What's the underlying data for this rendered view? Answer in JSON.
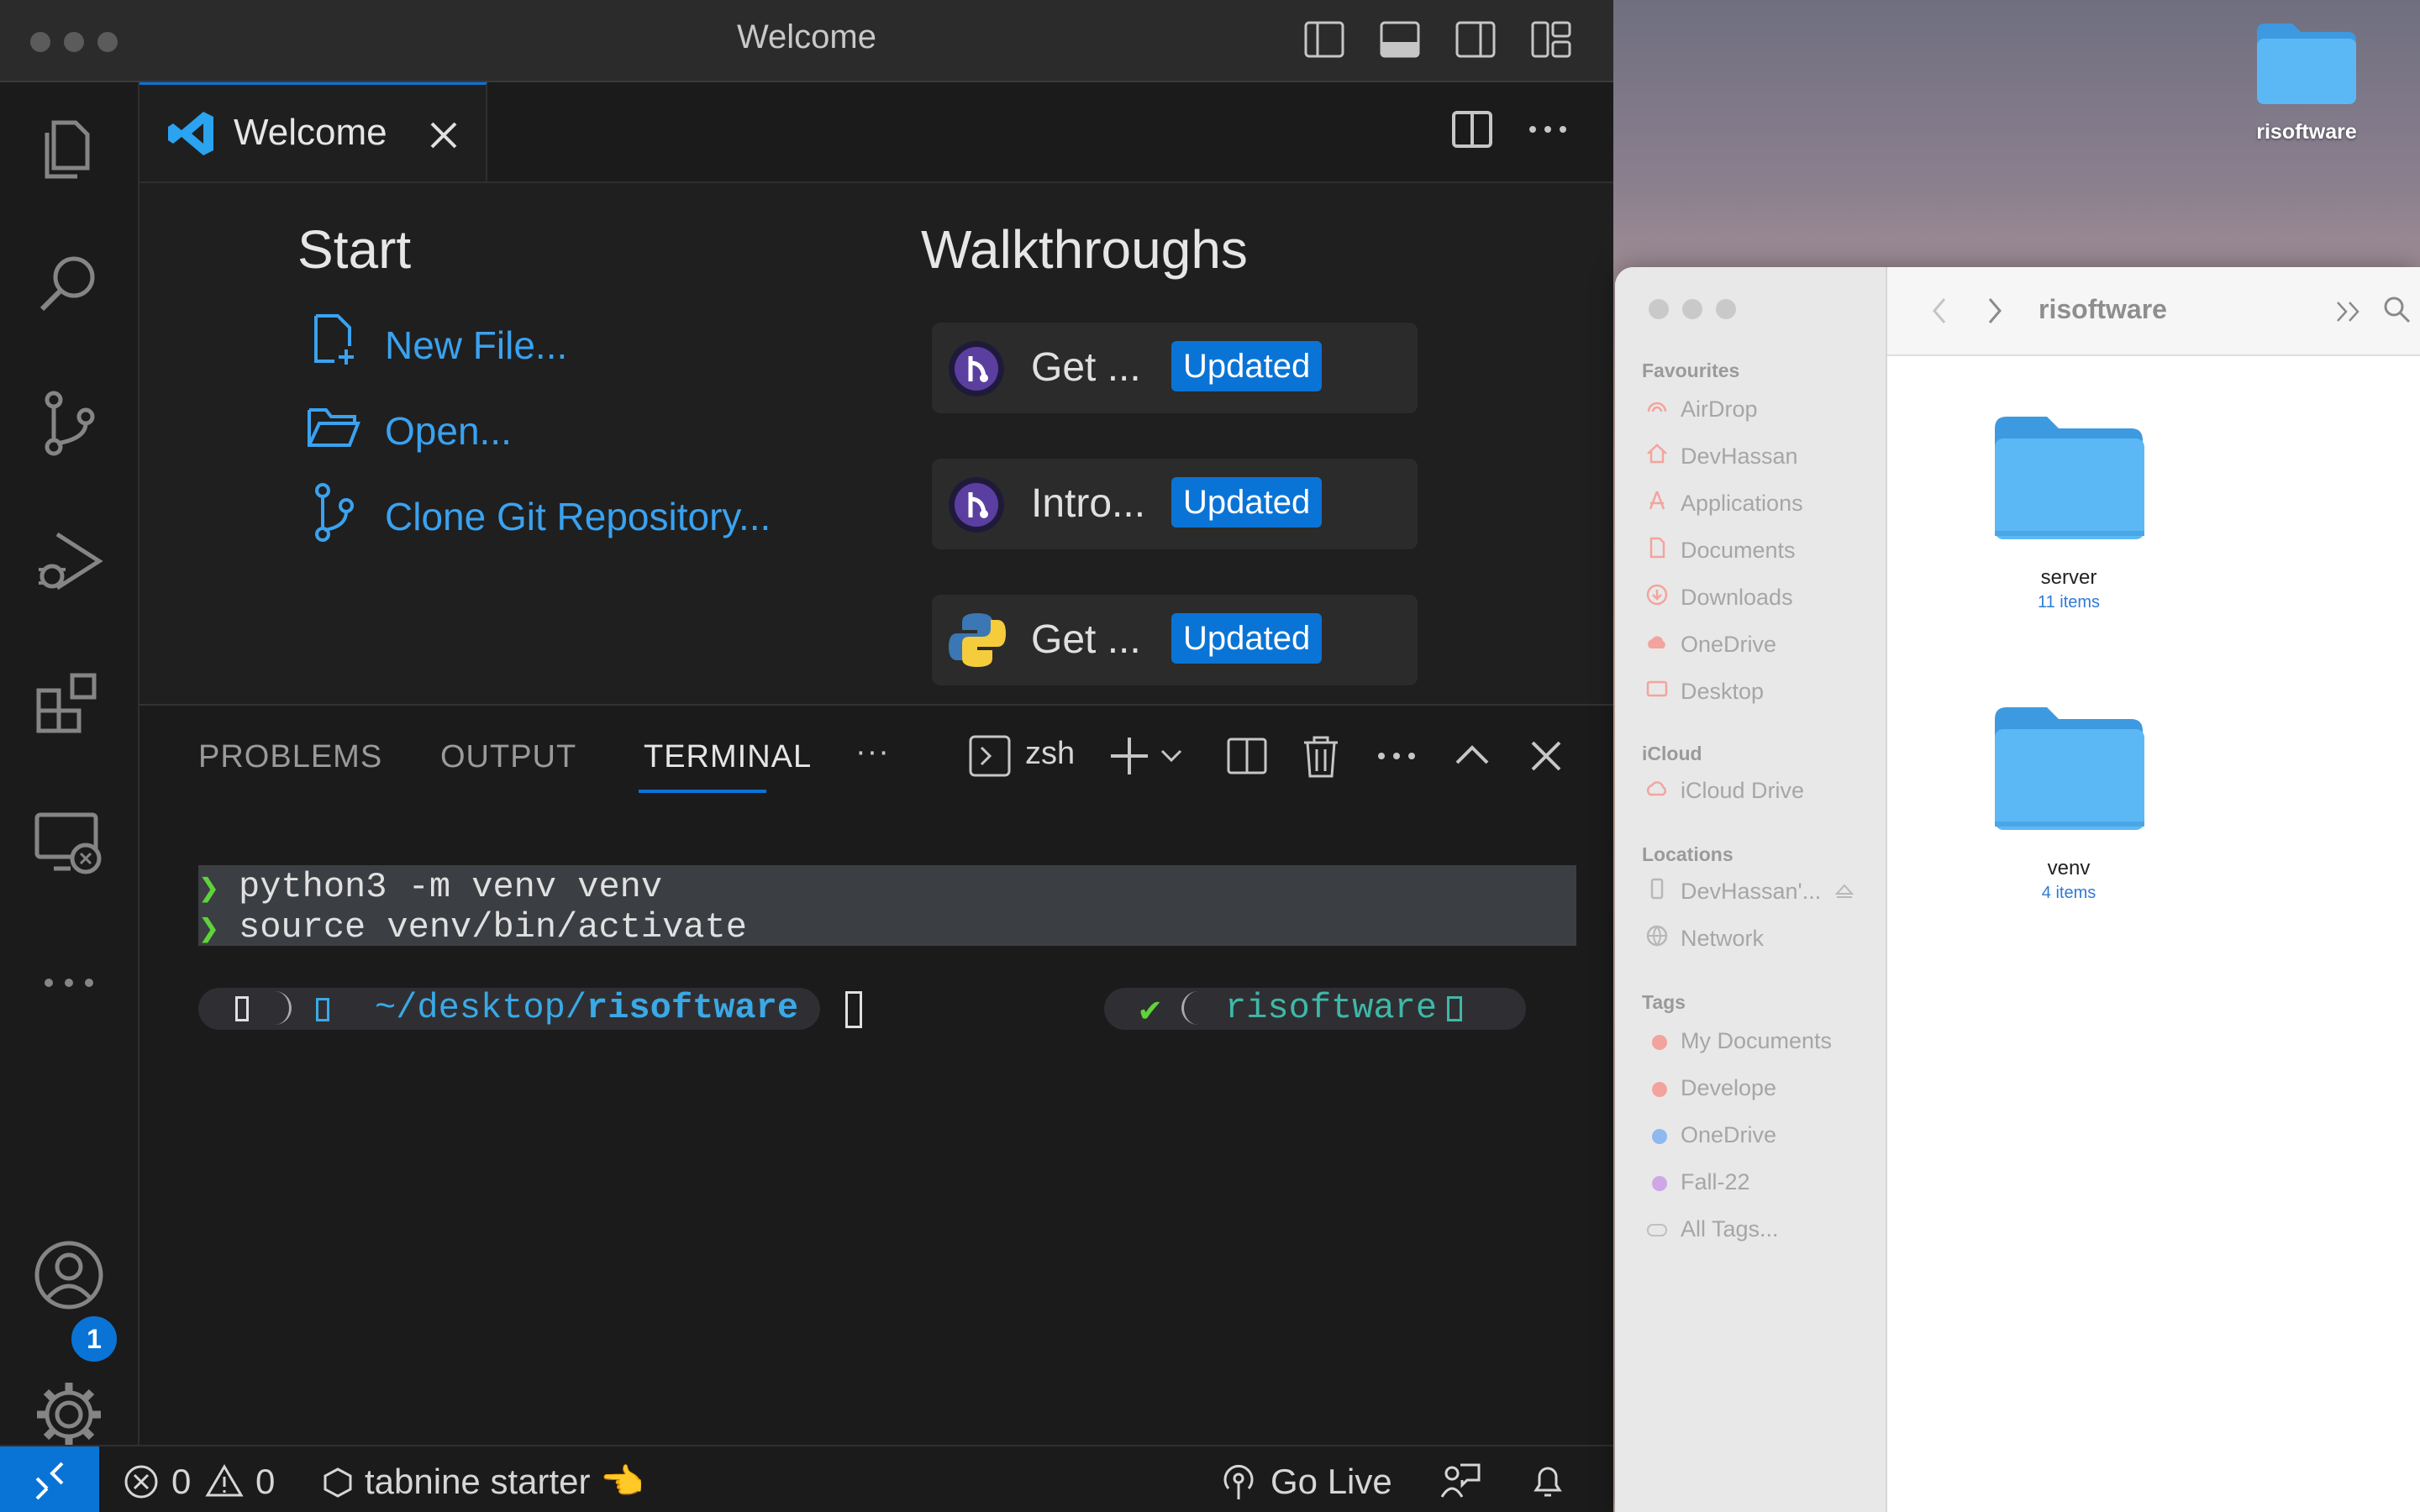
{
  "desktop": {
    "folder_label": "risoftware"
  },
  "vscode": {
    "window_title": "Welcome",
    "tab": {
      "label": "Welcome"
    },
    "activity": {
      "accounts_badge": "1"
    },
    "welcome": {
      "start_heading": "Start",
      "start_links": [
        "New File...",
        "Open...",
        "Clone Git Repository..."
      ],
      "walkthroughs_heading": "Walkthroughs",
      "walkthroughs": [
        {
          "title": "Get ...",
          "badge": "Updated",
          "icon": "git-walkthrough-icon"
        },
        {
          "title": "Intro...",
          "badge": "Updated",
          "icon": "git-walkthrough-icon"
        },
        {
          "title": "Get ...",
          "badge": "Updated",
          "icon": "python-icon"
        }
      ]
    },
    "panel": {
      "tabs": [
        "PROBLEMS",
        "OUTPUT",
        "TERMINAL"
      ],
      "more": "···",
      "shell": "zsh"
    },
    "terminal": {
      "prompt_glyph": "❯",
      "lines": [
        "python3 -m venv venv",
        "source venv/bin/activate"
      ],
      "path_prefix": "~/desktop/",
      "path_dir": "risoftware",
      "check": "✔",
      "env_name": "risoftware"
    },
    "status": {
      "errors": "0",
      "warnings": "0",
      "tabnine": "tabnine starter 👈",
      "go_live": "Go Live"
    },
    "colors": {
      "accent": "#0a74d6",
      "link": "#3aa2f0",
      "prompt": "#5fd33a",
      "path": "#3aa9e6",
      "env": "#3fb8a8"
    }
  },
  "finder": {
    "title": "risoftware",
    "sections": {
      "favourites": "Favourites",
      "icloud": "iCloud",
      "locations": "Locations",
      "tags": "Tags"
    },
    "favourites": [
      "AirDrop",
      "DevHassan",
      "Applications",
      "Documents",
      "Downloads",
      "OneDrive",
      "Desktop"
    ],
    "icloud": [
      "iCloud Drive"
    ],
    "locations": [
      "DevHassan'...",
      "Network"
    ],
    "tags": [
      {
        "label": "My Documents",
        "color": "#f2a39e"
      },
      {
        "label": "Develope",
        "color": "#f2a39e"
      },
      {
        "label": "OneDrive",
        "color": "#8fb8f0"
      },
      {
        "label": "Fall-22",
        "color": "#cfa6e6"
      },
      {
        "label": "All Tags...",
        "color": ""
      }
    ],
    "items": [
      {
        "name": "server",
        "count": "11 items"
      },
      {
        "name": "venv",
        "count": "4 items"
      }
    ]
  }
}
